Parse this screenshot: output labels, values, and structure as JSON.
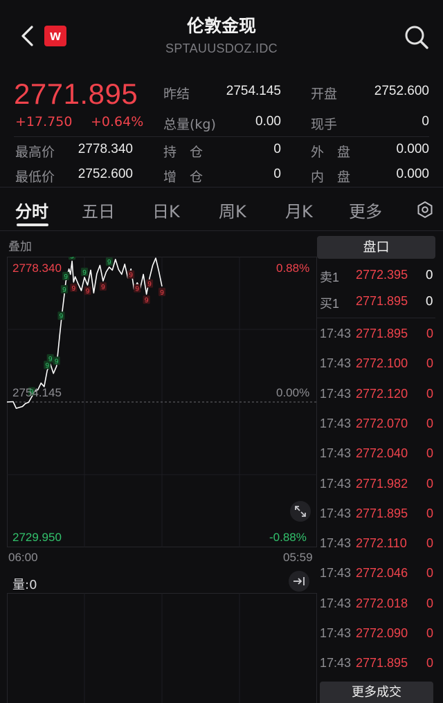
{
  "header": {
    "title": "伦敦金现",
    "subtitle": "SPTAUUSDOZ.IDC",
    "logo_letter": "w"
  },
  "quote": {
    "price": "2771.895",
    "change": "+17.750",
    "change_pct": "+0.64%",
    "prev_close_label": "昨结",
    "prev_close": "2754.145",
    "open_label": "开盘",
    "open": "2752.600",
    "total_vol_label": "总量(kg)",
    "total_vol": "0.00",
    "current_hand_label": "现手",
    "current_hand": "0",
    "high_label": "最高价",
    "high": "2778.340",
    "low_label": "最低价",
    "low": "2752.600",
    "hold_label": "持　仓",
    "hold": "0",
    "add_label": "增　仓",
    "add": "0",
    "outer_label": "外　盘",
    "outer": "0.000",
    "inner_label": "内　盘",
    "inner": "0.000"
  },
  "tabs": [
    "分时",
    "五日",
    "日K",
    "周K",
    "月K",
    "更多"
  ],
  "chart": {
    "overlay_label": "叠加",
    "top_price": "2778.340",
    "mid_price": "2754.145",
    "bottom_price": "2729.950",
    "top_pct": "0.88%",
    "mid_pct": "0.00%",
    "bottom_pct": "-0.88%",
    "time_start": "06:00",
    "time_end": "05:59",
    "volume_label": "量:0",
    "marker_glyph": "9"
  },
  "chart_data": {
    "type": "line",
    "x_range": [
      "06:00",
      "05:59"
    ],
    "ylim": [
      2729.95,
      2778.34
    ],
    "reference": 2754.145,
    "x_fraction": [
      0,
      0.02,
      0.03,
      0.05,
      0.06,
      0.07,
      0.08,
      0.09,
      0.1,
      0.11,
      0.12,
      0.13,
      0.14,
      0.15,
      0.16,
      0.17,
      0.175,
      0.18,
      0.185,
      0.19,
      0.2,
      0.205,
      0.21,
      0.215,
      0.22,
      0.23,
      0.24,
      0.25,
      0.26,
      0.27,
      0.28,
      0.29,
      0.3,
      0.31,
      0.32,
      0.33,
      0.34,
      0.35,
      0.36,
      0.37,
      0.38,
      0.39,
      0.4,
      0.41,
      0.42,
      0.43,
      0.44,
      0.45,
      0.46,
      0.47,
      0.48,
      0.49,
      0.5
    ],
    "values": [
      2754.15,
      2754.2,
      2753.1,
      2753.4,
      2753.9,
      2754.1,
      2755.0,
      2755.9,
      2756.2,
      2757.3,
      2756.7,
      2759.4,
      2760.5,
      2758.9,
      2760.1,
      2765.2,
      2767.6,
      2769.8,
      2772.0,
      2774.2,
      2776.3,
      2775.4,
      2777.6,
      2774.1,
      2775.0,
      2773.8,
      2772.7,
      2774.9,
      2773.6,
      2776.1,
      2772.3,
      2775.5,
      2776.9,
      2774.3,
      2775.8,
      2776.6,
      2776.1,
      2777.9,
      2776.2,
      2775.4,
      2777.1,
      2774.8,
      2776.3,
      2772.9,
      2774.0,
      2773.1,
      2775.4,
      2772.1,
      2774.8,
      2776.9,
      2778.1,
      2775.9,
      2773.4
    ]
  },
  "right_panel": {
    "pankou_label": "盘口",
    "sell1_label": "卖1",
    "sell1_price": "2772.395",
    "sell1_vol": "0",
    "buy1_label": "买1",
    "buy1_price": "2771.895",
    "buy1_vol": "0",
    "ticks": [
      {
        "time": "17:43",
        "price": "2771.895",
        "vol": "0"
      },
      {
        "time": "17:43",
        "price": "2772.100",
        "vol": "0"
      },
      {
        "time": "17:43",
        "price": "2772.120",
        "vol": "0"
      },
      {
        "time": "17:43",
        "price": "2772.070",
        "vol": "0"
      },
      {
        "time": "17:43",
        "price": "2772.040",
        "vol": "0"
      },
      {
        "time": "17:43",
        "price": "2771.982",
        "vol": "0"
      },
      {
        "time": "17:43",
        "price": "2771.895",
        "vol": "0"
      },
      {
        "time": "17:43",
        "price": "2772.110",
        "vol": "0"
      },
      {
        "time": "17:43",
        "price": "2772.046",
        "vol": "0"
      },
      {
        "time": "17:43",
        "price": "2772.018",
        "vol": "0"
      },
      {
        "time": "17:43",
        "price": "2772.090",
        "vol": "0"
      },
      {
        "time": "17:43",
        "price": "2771.895",
        "vol": "0"
      }
    ],
    "more_trades_label": "更多成交"
  },
  "colors": {
    "up": "#f0434c",
    "down": "#32c26c",
    "background": "#0f0f11",
    "line": "#ffffff",
    "grid": "#26262b"
  }
}
